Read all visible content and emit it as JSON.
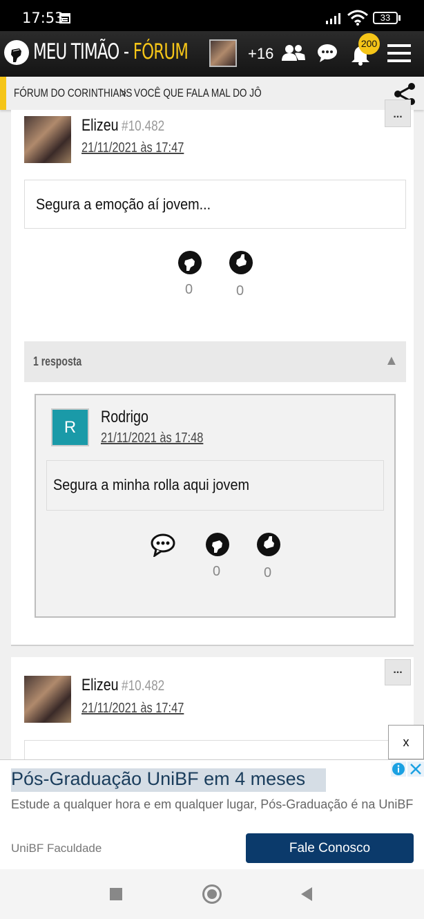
{
  "status_bar": {
    "time": "17:53",
    "battery": "33"
  },
  "header": {
    "logo_main": "MEU TIMÃO - ",
    "logo_forum": "FÓRUM",
    "online_count": "+16",
    "notifications": "200"
  },
  "breadcrumb": {
    "item1": "FÓRUM DO CORINTHIANS",
    "separator": ">",
    "item2": "VOCÊ QUE FALA MAL DO JÔ"
  },
  "post1": {
    "author": "Elizeu",
    "post_number": "#10.482",
    "date": "21/11/2021 às 17:47",
    "message": "Segura a emoção aí jovem...",
    "likes": "0",
    "dislikes": "0",
    "menu": "..."
  },
  "replies": {
    "label": "1 resposta",
    "toggle": "▲",
    "reply1": {
      "avatar_letter": "R",
      "author": "Rodrigo",
      "date": "21/11/2021 às 17:48",
      "message": "Segura a minha rolla aqui jovem",
      "likes": "0",
      "dislikes": "0"
    }
  },
  "post2": {
    "author": "Elizeu",
    "post_number": "#10.482",
    "date": "21/11/2021 às 17:47",
    "menu": "..."
  },
  "ad": {
    "close_small": "x",
    "title": "Pós-Graduação UniBF em 4 meses",
    "description": "Estude a qualquer hora e em qualquer lugar, Pós-Graduação é na UniBF",
    "advertiser": "UniBF Faculdade",
    "cta": "Fale Conosco"
  },
  "colors": {
    "accent": "#f5c518",
    "header_bg": "#1e1e1e",
    "cta_bg": "#0b3a6b",
    "reply_avatar_bg": "#1a9aa8"
  }
}
